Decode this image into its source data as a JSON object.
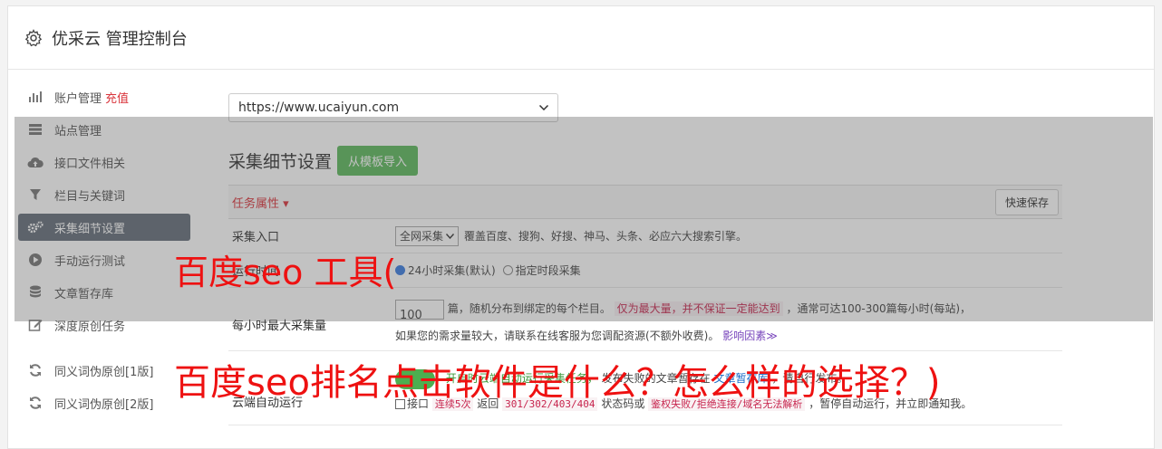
{
  "header": {
    "title": "优采云 管理控制台"
  },
  "sidebar": {
    "items": [
      {
        "label": "账户管理",
        "extra": "充值"
      },
      {
        "label": "站点管理"
      },
      {
        "label": "接口文件相关"
      },
      {
        "label": "栏目与关键词"
      },
      {
        "label": "采集细节设置"
      },
      {
        "label": "手动运行测试"
      },
      {
        "label": "文章暂存库"
      },
      {
        "label": "深度原创任务"
      },
      {
        "label": "同义词伪原创[1版]"
      },
      {
        "label": "同义词伪原创[2版]"
      }
    ]
  },
  "main": {
    "url_select": "https://www.ucaiyun.com",
    "section_title": "采集细节设置",
    "import_button": "从模板导入",
    "task_attr_label": "任务属性 ▾",
    "quick_save": "快速保存",
    "rows": {
      "entry": {
        "label": "采集入口",
        "select": "全网采集",
        "desc": "覆盖百度、搜狗、好搜、神马、头条、必应六大搜索引擎。"
      },
      "time": {
        "label": "运行时间",
        "opt1": "24小时采集(默认)",
        "opt2": "指定时段采集"
      },
      "max": {
        "label": "每小时最大采集量",
        "value": "100",
        "t1": "篇，随机分布到绑定的每个栏目。",
        "t2": "仅为最大量，并不保证一定能达到",
        "t3": "，通常可达100-300篇每小时(每站)，",
        "t4": "如果您的需求量较大，请联系在线客服为您调配资源(不额外收费)。",
        "t5": "影响因素"
      },
      "cloud": {
        "label": "云端自动运行",
        "t1": "开启时云端自动运行采集任务，",
        "t2": "发布失败的文章暂存在",
        "t3": "文章暂存库",
        "t4": "，请自行发布。",
        "chk": "接口",
        "c1": "连续5次",
        "c2": "返回",
        "c3": "301/302/403/404",
        "c4": "状态码或",
        "c5": "鉴权失败/拒绝连接/域名无法解析",
        "c6": "，暂停自动运行，并立即通知我。"
      }
    }
  },
  "watermark": {
    "line1": "百度seo 工具(",
    "line2": "百度seo排名点击软件是什么？怎么样的选择？)"
  }
}
